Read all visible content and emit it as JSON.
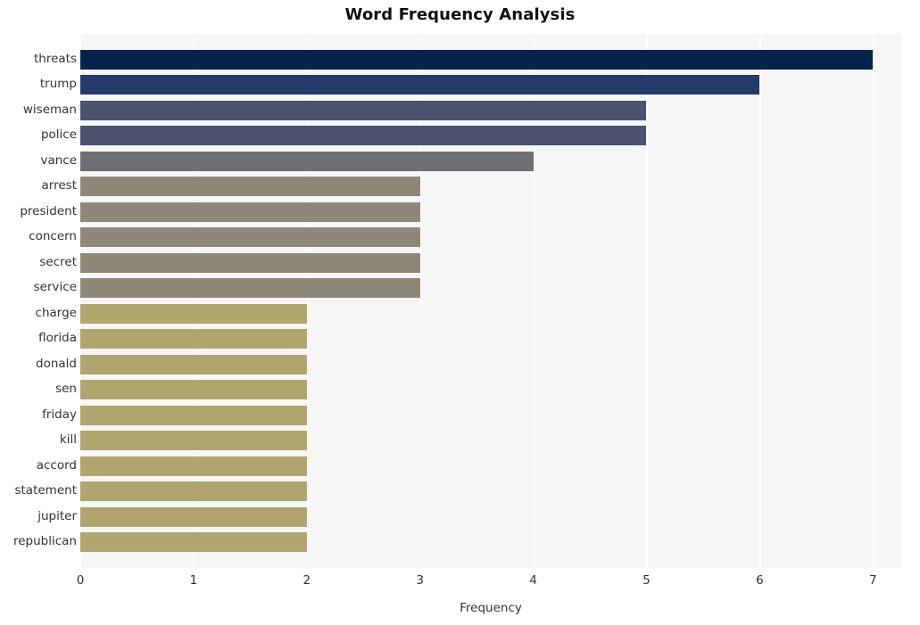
{
  "chart_data": {
    "type": "bar",
    "orientation": "horizontal",
    "title": "Word Frequency Analysis",
    "xlabel": "Frequency",
    "ylabel": "",
    "xlim": [
      0,
      7.25
    ],
    "xticks": [
      0,
      1,
      2,
      3,
      4,
      5,
      6,
      7
    ],
    "xticklabels": [
      "0",
      "1",
      "2",
      "3",
      "4",
      "5",
      "6",
      "7"
    ],
    "grid": true,
    "grid_axis": "x",
    "legend": false,
    "categories": [
      "threats",
      "trump",
      "wiseman",
      "police",
      "vance",
      "arrest",
      "president",
      "concern",
      "secret",
      "service",
      "charge",
      "florida",
      "donald",
      "sen",
      "friday",
      "kill",
      "accord",
      "statement",
      "jupiter",
      "republican"
    ],
    "values": [
      7,
      6,
      5,
      5,
      4,
      3,
      3,
      3,
      3,
      3,
      2,
      2,
      2,
      2,
      2,
      2,
      2,
      2,
      2,
      2
    ],
    "bar_colors": [
      "#04244b",
      "#253a6a",
      "#4b5270",
      "#4b5270",
      "#6e7076",
      "#8d8878",
      "#8d8878",
      "#8d8878",
      "#8d8878",
      "#8d8878",
      "#b1a56e",
      "#b1a56e",
      "#b1a56e",
      "#b1a56e",
      "#b1a56e",
      "#b1a56e",
      "#b1a56e",
      "#b1a56e",
      "#b1a56e",
      "#b1a56e"
    ]
  },
  "style": {
    "plot_background": "#f6f6f6",
    "figure_background": "#ffffff",
    "gridline_color": "#ffffff",
    "tick_label_color": "#333333",
    "title_color": "#111111"
  }
}
